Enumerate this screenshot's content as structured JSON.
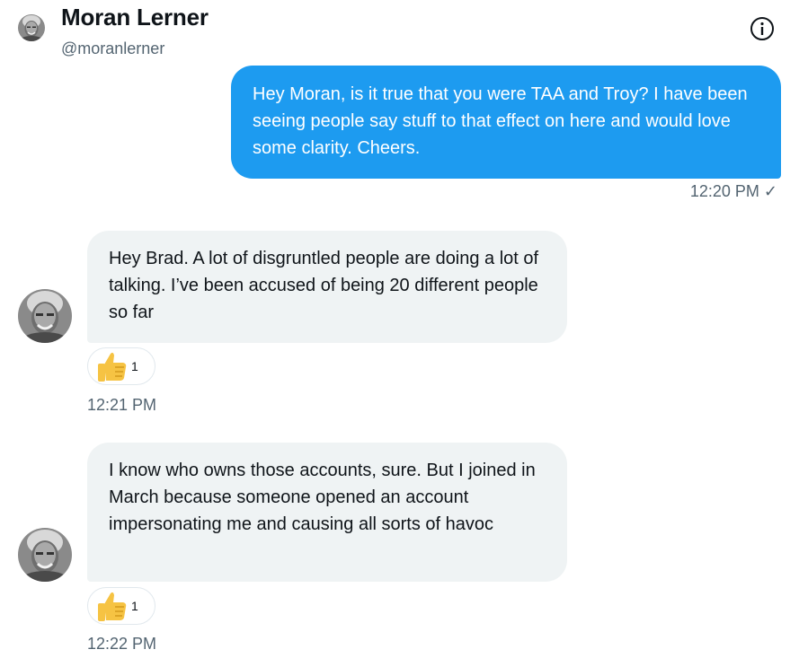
{
  "header": {
    "name": "Moran Lerner",
    "handle": "@moranlerner",
    "info_icon": "info-icon"
  },
  "messages": [
    {
      "direction": "outgoing",
      "text": "Hey Moran, is it true that you were TAA and Troy? I have been seeing people say stuff to that effect on here and would love some clarity. Cheers.",
      "time": "12:20 PM",
      "status": "✓"
    },
    {
      "direction": "incoming",
      "text": "Hey Brad. A lot of disgruntled people are doing a lot of talking. I’ve been accused of being 20 different people so far",
      "reaction": {
        "icon": "thumbs-up-icon",
        "count": "1"
      },
      "time": "12:21 PM"
    },
    {
      "direction": "incoming",
      "text": "I know who owns those accounts, sure. But I joined in March because someone opened an account impersonating me and causing all sorts of havoc",
      "reaction": {
        "icon": "thumbs-up-icon",
        "count": "1"
      },
      "time": "12:22 PM"
    }
  ],
  "colors": {
    "outgoing_bubble": "#1d9bf0",
    "incoming_bubble": "#eff3f4",
    "secondary_text": "#536471",
    "reaction_thumb": "#f6c343"
  }
}
